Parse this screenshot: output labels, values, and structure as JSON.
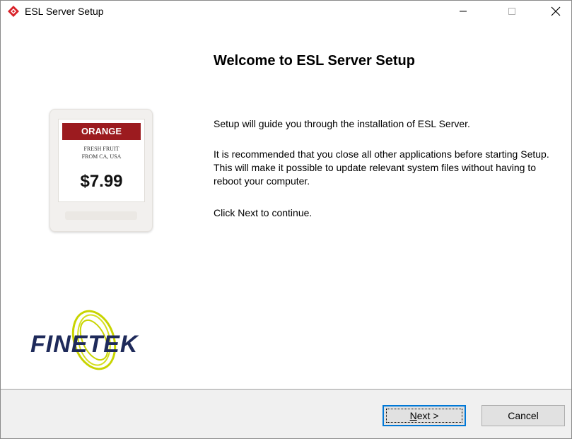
{
  "window": {
    "title": "ESL Server Setup",
    "controls": {
      "minimize": "—",
      "maximize": "☐",
      "close": "✕"
    }
  },
  "welcome": {
    "title": "Welcome to ESL Server Setup",
    "paragraph1": "Setup will guide you through the installation of ESL Server.",
    "paragraph2": "It is recommended that you close all other applications before starting Setup. This will make it possible to update relevant system files without having to reboot your computer.",
    "paragraph3": "Click Next to continue."
  },
  "price_tag": {
    "banner": "ORANGE",
    "line1": "FRESH FRUIT",
    "line2": "FROM CA, USA",
    "price": "$7.99",
    "banner_color": "#9c1b1f"
  },
  "logo": {
    "text": "FINETEK",
    "text_color": "#1e2a5a",
    "swirl_color": "#c8d400"
  },
  "buttons": {
    "next_mnemonic": "N",
    "next_rest": "ext >",
    "cancel": "Cancel"
  },
  "icons": {
    "app": "diamond-arrows-icon"
  },
  "colors": {
    "focus_border": "#0078d7",
    "footer_bg": "#f0f0f0"
  }
}
